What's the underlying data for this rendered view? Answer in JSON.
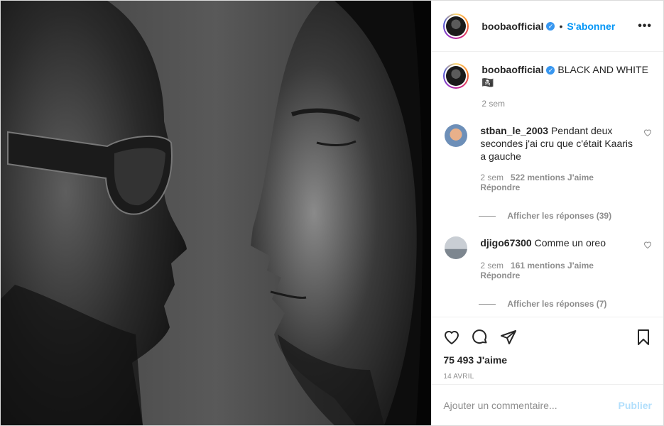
{
  "post": {
    "author": "boobaofficial",
    "follow_label": "S'abonner",
    "more_label": "•••",
    "caption_text": "BLACK AND WHITE 🏴‍☠️",
    "caption_time": "2 sem",
    "likes": "75 493 J'aime",
    "date": "14 AVRIL",
    "comment_placeholder": "Ajouter un commentaire...",
    "publish_label": "Publier"
  },
  "comments": [
    {
      "user": "stban_le_2003",
      "text": "Pendant deux secondes j'ai cru que c'était Kaaris a gauche",
      "time": "2 sem",
      "likes": "522 mentions J'aime",
      "reply": "Répondre",
      "view_replies": "Afficher les réponses (39)"
    },
    {
      "user": "djigo67300",
      "text": "Comme un oreo",
      "time": "2 sem",
      "likes": "161 mentions J'aime",
      "reply": "Répondre",
      "view_replies": "Afficher les réponses (7)"
    }
  ],
  "icons": {
    "like": "heart-icon",
    "comment": "comment-icon",
    "share": "paper-plane-icon",
    "save": "bookmark-icon",
    "verified": "verified-badge-icon",
    "flag": "pirate-flag-emoji"
  },
  "colors": {
    "link": "#0095f6",
    "verified": "#3897f0",
    "muted": "#8e8e8e",
    "publish_disabled": "#b2dffc"
  }
}
